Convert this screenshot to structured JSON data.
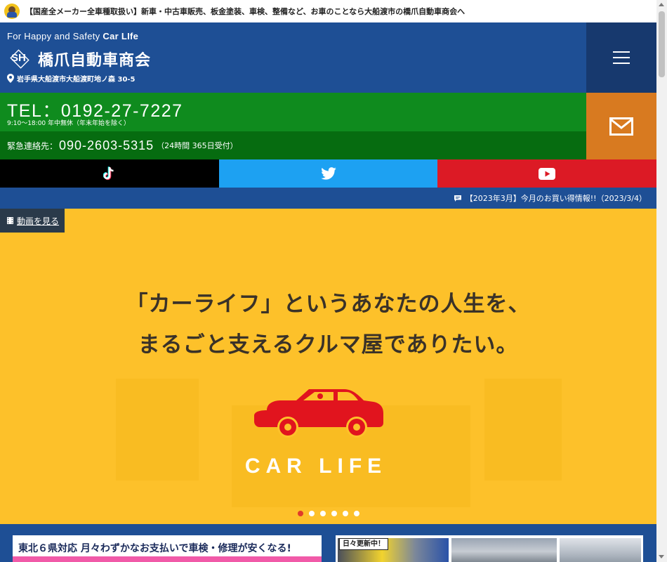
{
  "topbar": {
    "text": "【国産全メーカー全車種取扱い】新車・中古車販売、板金塗装、車検、整備など、お車のことなら大船渡市の橋爪自動車商会へ"
  },
  "header": {
    "tagline_prefix": "For Happy and Safety ",
    "tagline_strong": "Car LIfe",
    "company_name": "橋爪自動車商会",
    "logo_letters": "SH",
    "address": "岩手県大船渡市大船渡町地ノ森 30-5"
  },
  "contact": {
    "tel": "TEL：0192-27-7227",
    "hours": "9:10〜18:00 年中無休（年末年始を除く）",
    "emergency_label": "緊急連絡先：",
    "emergency_number": "090-2603-5315",
    "emergency_note": "（24時間 365日受付）"
  },
  "news": {
    "text": "【2023年3月】今月のお買い得情報!!（2023/3/4）"
  },
  "hero": {
    "video_button": "動画を見る",
    "headline_line1": "「カーライフ」というあなたの人生を、",
    "headline_line2": "まるごと支えるクルマ屋でありたい。",
    "car_label": "CAR LIFE",
    "slides": [
      true,
      false,
      false,
      false,
      false,
      false
    ]
  },
  "banners": {
    "banner1_text": "東北６県対応 月々わずかなお支払いで車検・修理が安くなる!",
    "banner2_tag": "日々更新中！"
  },
  "colors": {
    "header_blue": "#1e4f95",
    "tel_green": "#0f8b1e",
    "mail_orange": "#d87a20",
    "hero_yellow": "#fdc12a",
    "car_red": "#e1141e"
  }
}
